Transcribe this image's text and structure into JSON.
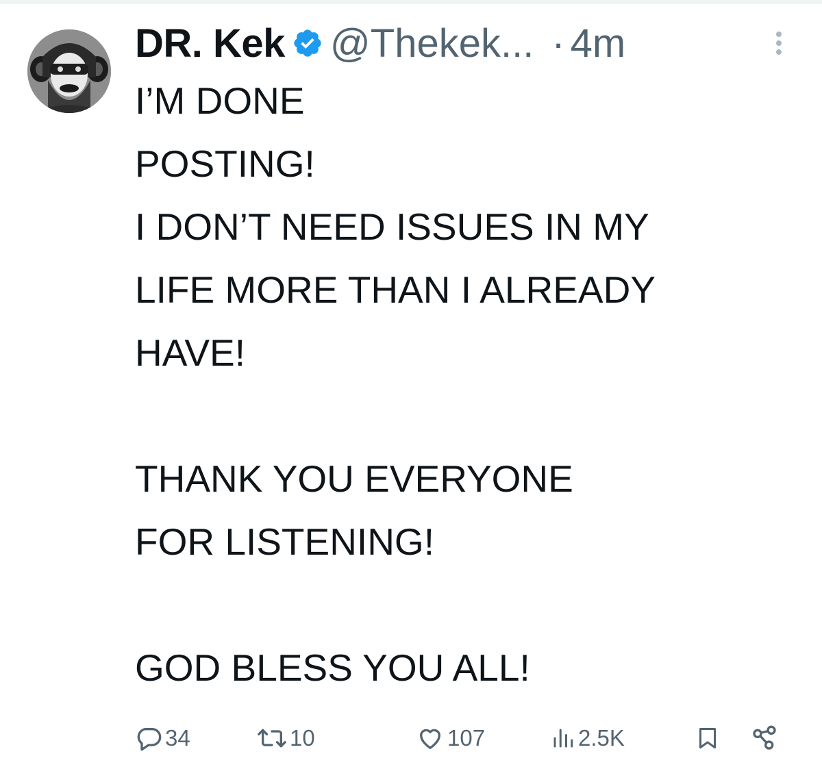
{
  "tweet": {
    "author": {
      "display_name": "DR. Kek",
      "handle": "@Thekek...",
      "verified": true,
      "avatar_icon": "avatar-portrait-icon"
    },
    "separator": "·",
    "time": "4m",
    "text_lines": [
      "I’M DONE",
      "POSTING!",
      "I DON’T NEED ISSUES IN MY",
      "LIFE MORE THAN I ALREADY",
      "HAVE!",
      "",
      "THANK YOU EVERYONE",
      "FOR LISTENING!",
      "",
      "GOD BLESS YOU ALL!"
    ],
    "actions": {
      "replies": "34",
      "reposts": "10",
      "likes": "107",
      "views": "2.5K"
    }
  },
  "colors": {
    "text_primary": "#0f1419",
    "text_secondary": "#536471",
    "verified_blue": "#1d9bf0",
    "divider": "#eff3f4"
  },
  "icons": {
    "reply": "reply-icon",
    "repost": "repost-icon",
    "like": "heart-icon",
    "views": "views-chart-icon",
    "bookmark": "bookmark-icon",
    "share": "share-icon",
    "more": "more-vertical-icon",
    "verified": "verified-badge-icon"
  }
}
